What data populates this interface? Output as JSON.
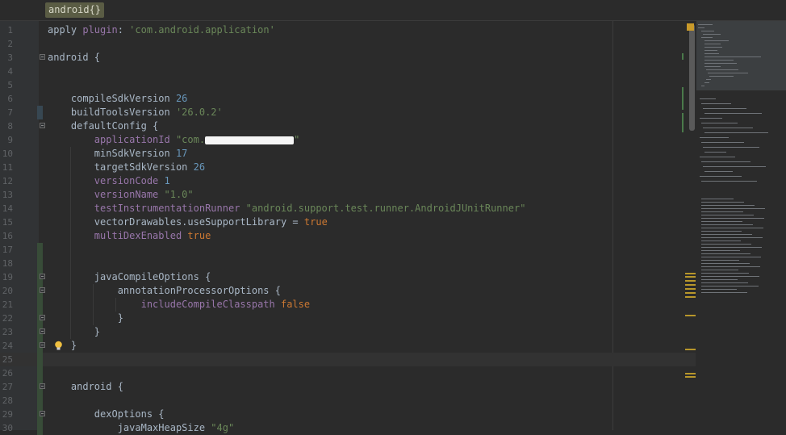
{
  "breadcrumb": {
    "label": "android{}"
  },
  "lines": [
    {
      "n": "1",
      "tokens": [
        {
          "t": "apply ",
          "c": "plain"
        },
        {
          "t": "plugin",
          "c": "prop"
        },
        {
          "t": ": ",
          "c": "plain"
        },
        {
          "t": "'com.android.application'",
          "c": "str"
        }
      ]
    },
    {
      "n": "2",
      "tokens": []
    },
    {
      "n": "3",
      "tokens": [
        {
          "t": "android {",
          "c": "plain"
        }
      ]
    },
    {
      "n": "4",
      "tokens": []
    },
    {
      "n": "5",
      "tokens": []
    },
    {
      "n": "6",
      "tokens": [
        {
          "t": "    compileSdkVersion ",
          "c": "plain"
        },
        {
          "t": "26",
          "c": "num"
        }
      ]
    },
    {
      "n": "7",
      "tokens": [
        {
          "t": "    buildToolsVersion ",
          "c": "plain"
        },
        {
          "t": "'26.0.2'",
          "c": "str"
        }
      ]
    },
    {
      "n": "8",
      "tokens": [
        {
          "t": "    defaultConfig {",
          "c": "plain"
        }
      ]
    },
    {
      "n": "9",
      "tokens": [
        {
          "t": "        applicationId ",
          "c": "prop"
        },
        {
          "t": "\"com.",
          "c": "str"
        },
        {
          "t": "",
          "c": "redact"
        },
        {
          "t": "\"",
          "c": "str"
        }
      ]
    },
    {
      "n": "10",
      "tokens": [
        {
          "t": "        minSdkVersion ",
          "c": "plain"
        },
        {
          "t": "17",
          "c": "num"
        }
      ]
    },
    {
      "n": "11",
      "tokens": [
        {
          "t": "        targetSdkVersion ",
          "c": "plain"
        },
        {
          "t": "26",
          "c": "num"
        }
      ]
    },
    {
      "n": "12",
      "tokens": [
        {
          "t": "        versionCode ",
          "c": "prop"
        },
        {
          "t": "1",
          "c": "num"
        }
      ]
    },
    {
      "n": "13",
      "tokens": [
        {
          "t": "        versionName ",
          "c": "prop"
        },
        {
          "t": "\"1.0\"",
          "c": "str"
        }
      ]
    },
    {
      "n": "14",
      "tokens": [
        {
          "t": "        testInstrumentationRunner ",
          "c": "prop"
        },
        {
          "t": "\"android.support.test.runner.AndroidJUnitRunner\"",
          "c": "str"
        }
      ]
    },
    {
      "n": "15",
      "tokens": [
        {
          "t": "        vectorDrawables.useSupportLibrary = ",
          "c": "plain"
        },
        {
          "t": "true",
          "c": "kw"
        }
      ]
    },
    {
      "n": "16",
      "tokens": [
        {
          "t": "        multiDexEnabled ",
          "c": "prop"
        },
        {
          "t": "true",
          "c": "kw"
        }
      ]
    },
    {
      "n": "17",
      "tokens": []
    },
    {
      "n": "18",
      "tokens": []
    },
    {
      "n": "19",
      "tokens": [
        {
          "t": "        javaCompileOptions {",
          "c": "plain"
        }
      ]
    },
    {
      "n": "20",
      "tokens": [
        {
          "t": "            annotationProcessorOptions {",
          "c": "plain"
        }
      ]
    },
    {
      "n": "21",
      "tokens": [
        {
          "t": "                includeCompileClasspath ",
          "c": "prop"
        },
        {
          "t": "false",
          "c": "kw"
        }
      ]
    },
    {
      "n": "22",
      "tokens": [
        {
          "t": "            }",
          "c": "plain"
        }
      ]
    },
    {
      "n": "23",
      "tokens": [
        {
          "t": "        }",
          "c": "plain"
        }
      ]
    },
    {
      "n": "24",
      "tokens": [
        {
          "t": "    }",
          "c": "plain"
        }
      ]
    },
    {
      "n": "25",
      "tokens": []
    },
    {
      "n": "26",
      "tokens": []
    },
    {
      "n": "27",
      "tokens": [
        {
          "t": "    android {",
          "c": "plain"
        }
      ]
    },
    {
      "n": "28",
      "tokens": []
    },
    {
      "n": "29",
      "tokens": [
        {
          "t": "        dexOptions {",
          "c": "plain"
        }
      ]
    },
    {
      "n": "30",
      "tokens": [
        {
          "t": "            javaMaxHeapSize ",
          "c": "plain"
        },
        {
          "t": "\"4g\"",
          "c": "str"
        }
      ]
    }
  ],
  "current_line": "25",
  "fold_lines": [
    "3",
    "8",
    "19",
    "20",
    "22",
    "23",
    "24",
    "27",
    "29"
  ],
  "added_lines": [
    "17",
    "18",
    "19",
    "20",
    "21",
    "22",
    "23",
    "24",
    "25",
    "26",
    "27",
    "28",
    "29",
    "30"
  ],
  "modified_lines": [
    "7"
  ],
  "icons": {
    "intention": "lightbulb-icon",
    "fold": "fold-marker-icon"
  },
  "colors": {
    "background": "#2b2b2b",
    "keyword": "#cc7832",
    "string": "#6a8759",
    "number": "#6897bb",
    "property": "#9876aa",
    "text": "#a9b7c6",
    "warning_marker": "#b8972b"
  }
}
